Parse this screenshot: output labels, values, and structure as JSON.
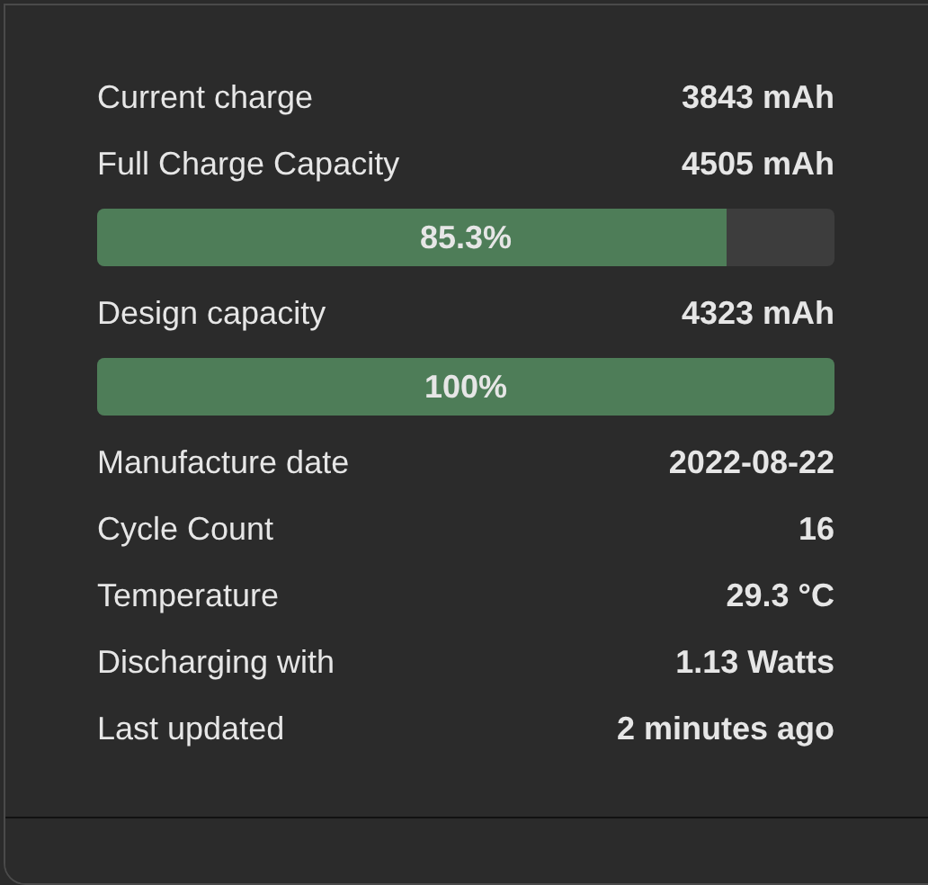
{
  "items": [
    {
      "kind": "row",
      "label": "Current charge",
      "value": "3843 mAh"
    },
    {
      "kind": "row",
      "label": "Full Charge Capacity",
      "value": "4505 mAh"
    },
    {
      "kind": "bar",
      "text": "85.3%",
      "level": 0.853
    },
    {
      "kind": "row",
      "label": "Design capacity",
      "value": "4323 mAh"
    },
    {
      "kind": "bar",
      "text": "100%",
      "level": 1
    },
    {
      "kind": "row",
      "label": "Manufacture date",
      "value": "2022-08-22"
    },
    {
      "kind": "row",
      "label": "Cycle Count",
      "value": "16"
    },
    {
      "kind": "row",
      "label": "Temperature",
      "value": "29.3 °C"
    },
    {
      "kind": "row",
      "label": "Discharging with",
      "value": "1.13 Watts"
    },
    {
      "kind": "row",
      "label": "Last updated",
      "value": "2 minutes ago"
    }
  ]
}
